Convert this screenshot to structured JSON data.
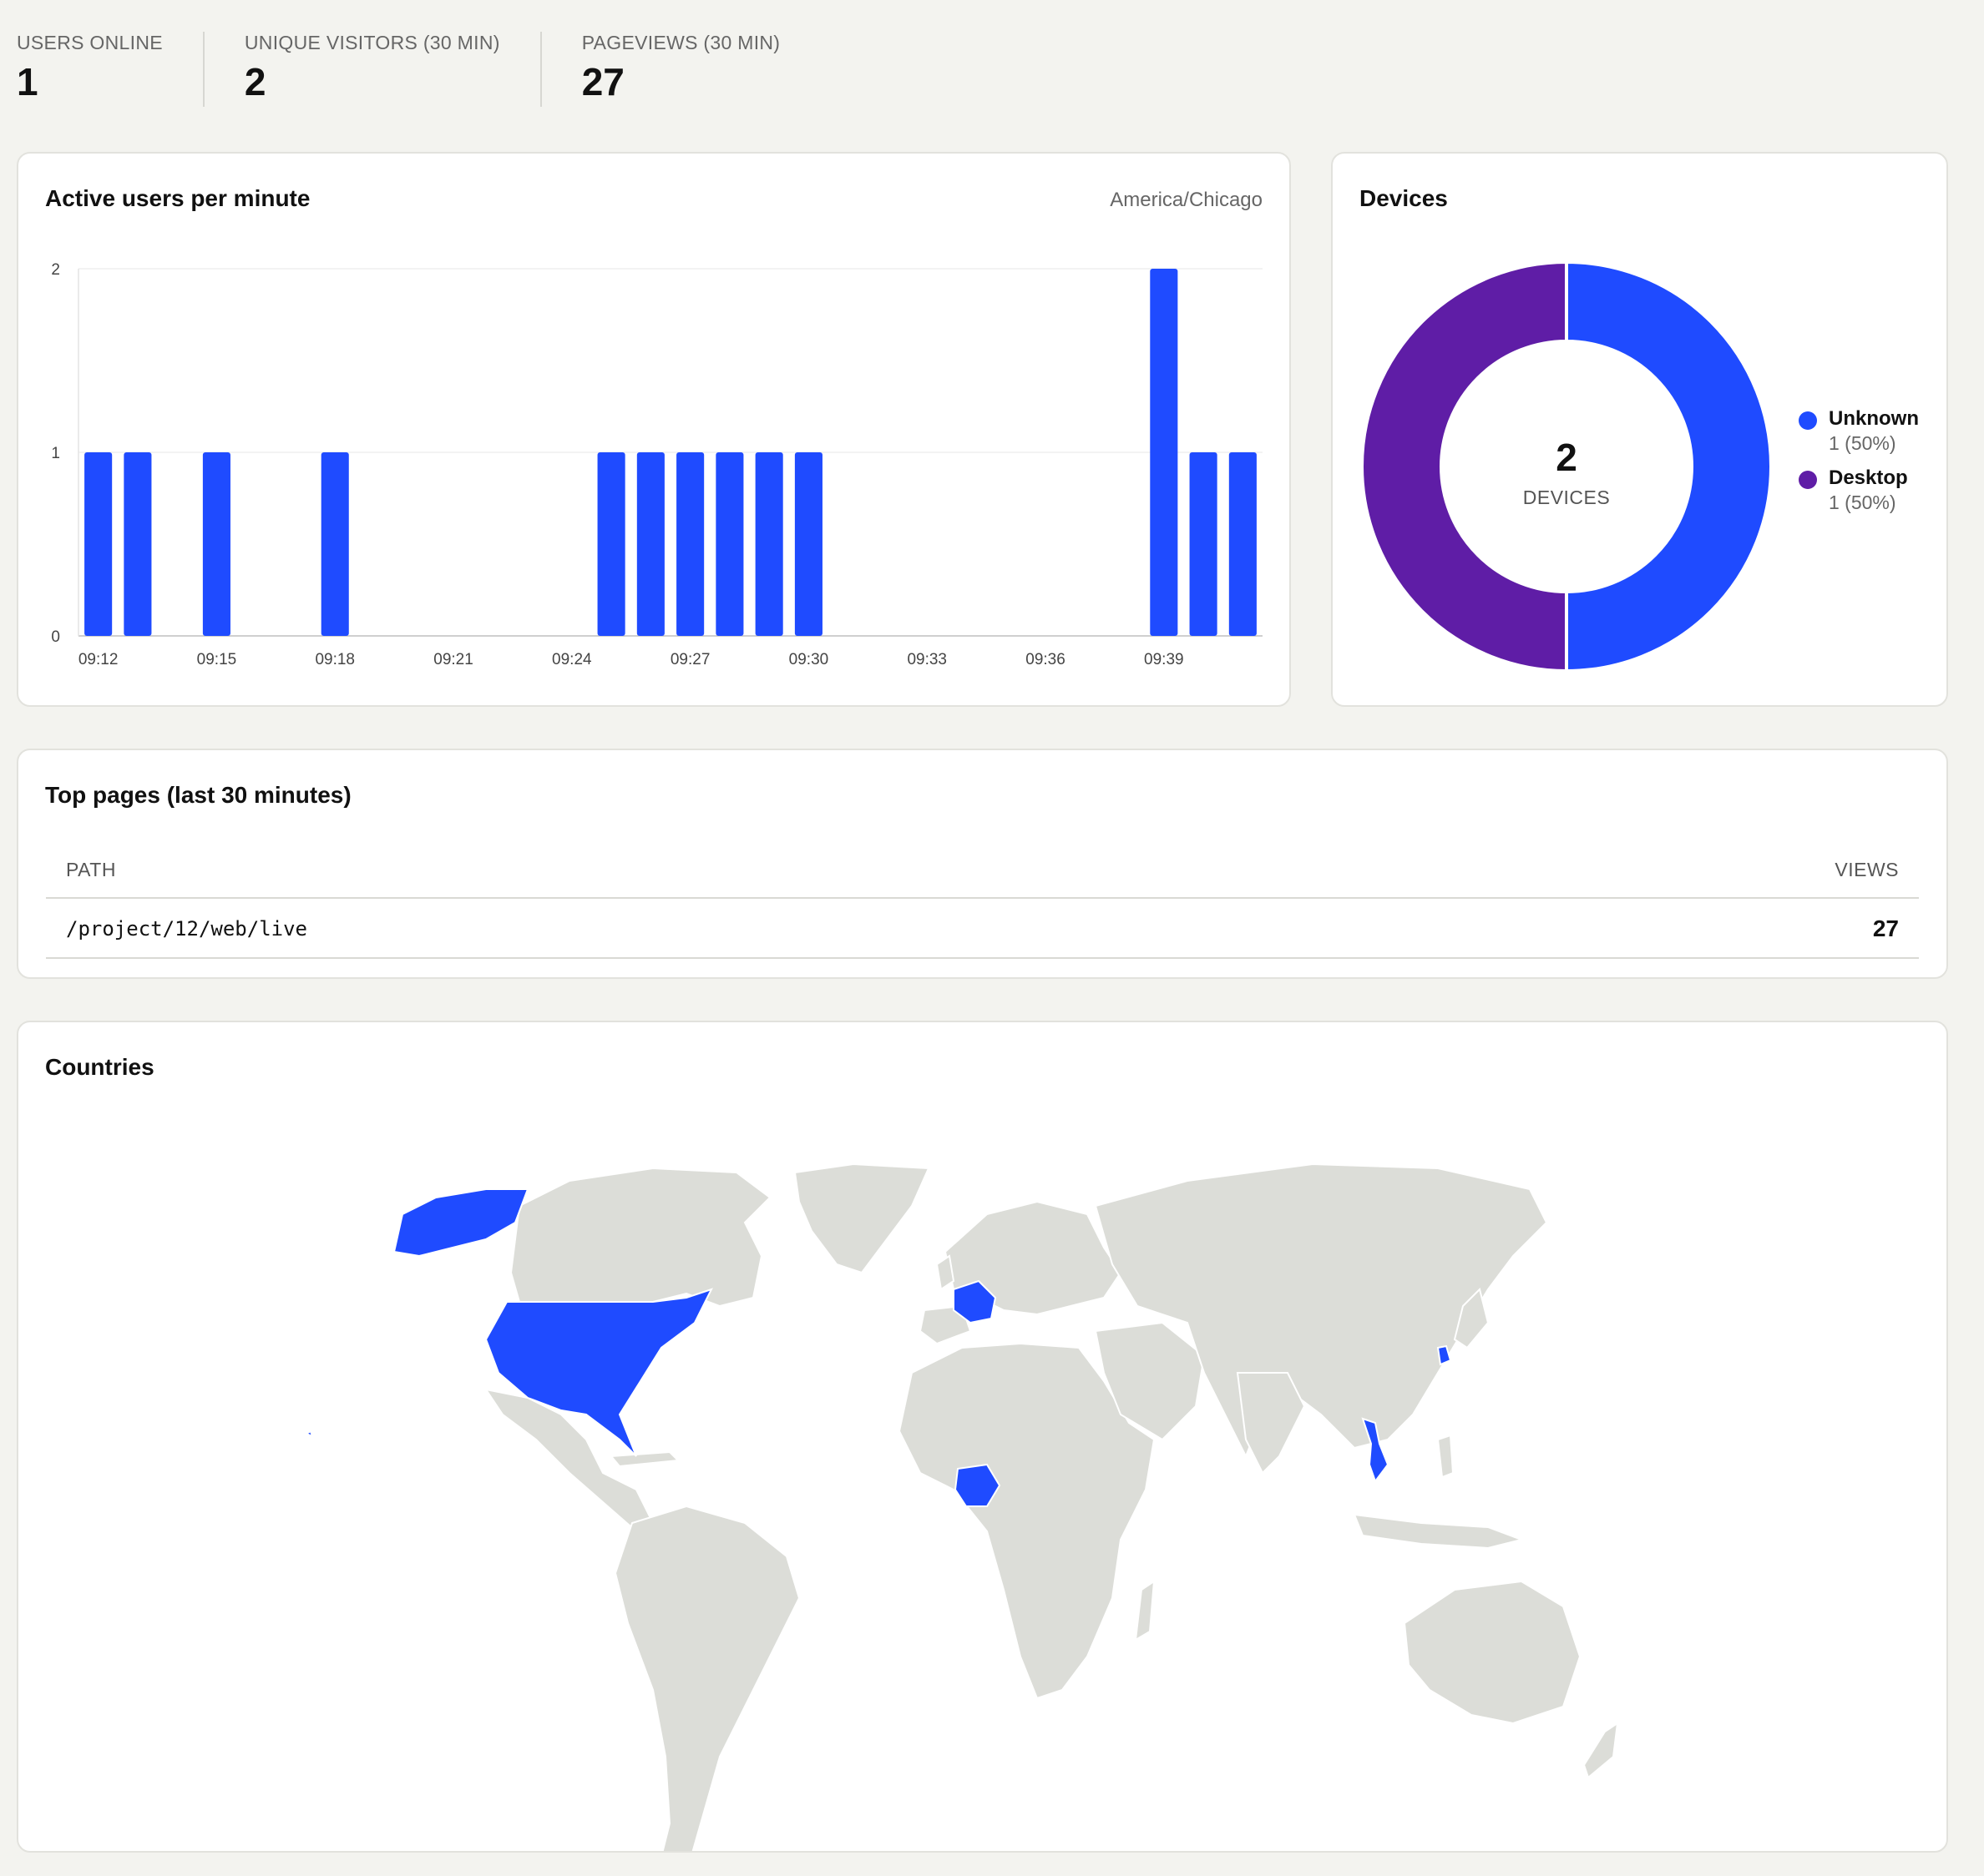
{
  "stats": [
    {
      "label": "USERS ONLINE",
      "value": "1"
    },
    {
      "label": "UNIQUE VISITORS (30 MIN)",
      "value": "2"
    },
    {
      "label": "PAGEVIEWS (30 MIN)",
      "value": "27"
    }
  ],
  "active_users": {
    "title": "Active users per minute",
    "timezone": "America/Chicago"
  },
  "devices": {
    "title": "Devices",
    "total": "2",
    "total_label": "DEVICES",
    "items": [
      {
        "name": "Unknown",
        "value_text": "1 (50%)",
        "color": "#1f4bff"
      },
      {
        "name": "Desktop",
        "value_text": "1 (50%)",
        "color": "#5f1da6"
      }
    ]
  },
  "top_pages": {
    "title": "Top pages (last 30 minutes)",
    "col_path": "PATH",
    "col_views": "VIEWS",
    "rows": [
      {
        "path": "/project/12/web/live",
        "views": "27"
      }
    ]
  },
  "countries": {
    "title": "Countries",
    "highlight_color": "#1f4bff",
    "land_color": "#dcddd8",
    "highlighted": [
      "United States",
      "France",
      "Nigeria",
      "Vietnam",
      "South Korea"
    ]
  },
  "chart_data": [
    {
      "type": "bar",
      "title": "Active users per minute",
      "x": [
        "09:12",
        "09:13",
        "09:14",
        "09:15",
        "09:16",
        "09:17",
        "09:18",
        "09:19",
        "09:20",
        "09:21",
        "09:22",
        "09:23",
        "09:24",
        "09:25",
        "09:26",
        "09:27",
        "09:28",
        "09:29",
        "09:30",
        "09:31",
        "09:32",
        "09:33",
        "09:34",
        "09:35",
        "09:36",
        "09:37",
        "09:38",
        "09:39",
        "09:40",
        "09:41"
      ],
      "values": [
        1,
        1,
        0,
        1,
        0,
        0,
        1,
        0,
        0,
        0,
        0,
        0,
        0,
        1,
        1,
        1,
        1,
        1,
        1,
        0,
        0,
        0,
        0,
        0,
        0,
        0,
        0,
        2,
        1,
        1
      ],
      "xticks": [
        "09:12",
        "09:15",
        "09:18",
        "09:21",
        "09:24",
        "09:27",
        "09:30",
        "09:33",
        "09:36",
        "09:39"
      ],
      "yticks": [
        "0",
        "1",
        "2"
      ],
      "ylim": [
        0,
        2
      ],
      "color": "#1f4bff",
      "grid": true
    },
    {
      "type": "pie",
      "title": "Devices",
      "labels": [
        "Unknown",
        "Desktop"
      ],
      "values": [
        1,
        1
      ],
      "colors": [
        "#1f4bff",
        "#5f1da6"
      ]
    }
  ]
}
